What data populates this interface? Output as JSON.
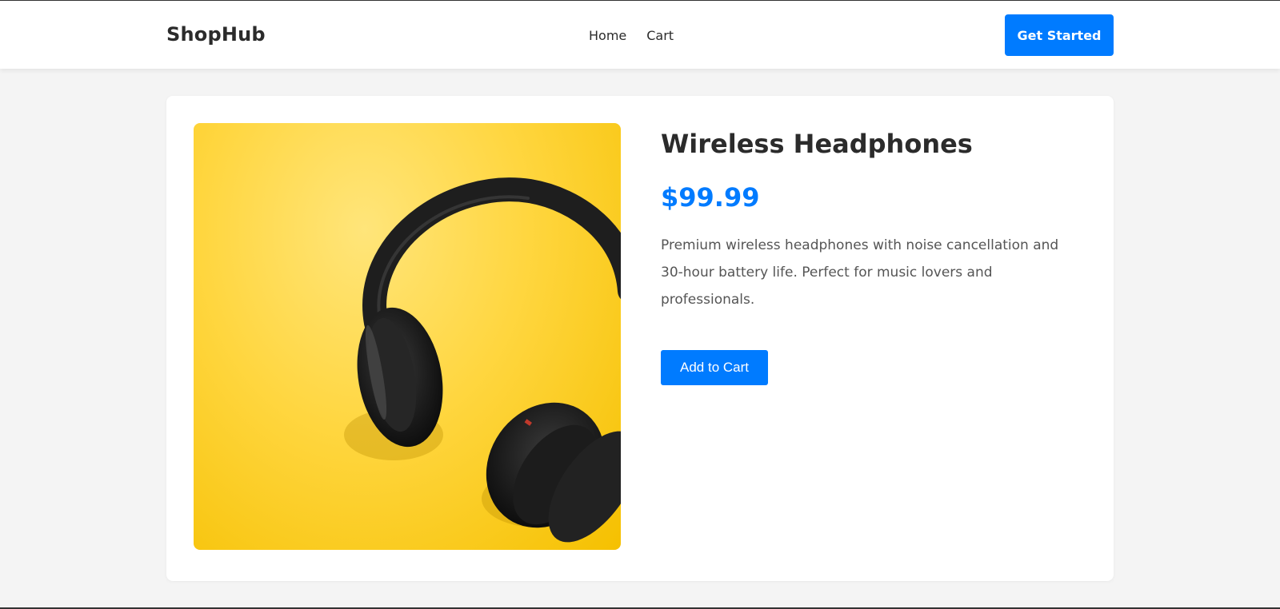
{
  "header": {
    "brand": "ShopHub",
    "nav": {
      "home": "Home",
      "cart": "Cart"
    },
    "cta_label": "Get Started"
  },
  "product": {
    "image_alt": "headphones-image",
    "title": "Wireless Headphones",
    "price": "$99.99",
    "description": "Premium wireless headphones with noise cancellation and 30-hour battery life. Perfect for music lovers and professionals.",
    "add_to_cart_label": "Add to Cart"
  },
  "colors": {
    "accent": "#007bff",
    "page_bg": "#f4f4f4",
    "image_bg": "#ffd63f"
  }
}
